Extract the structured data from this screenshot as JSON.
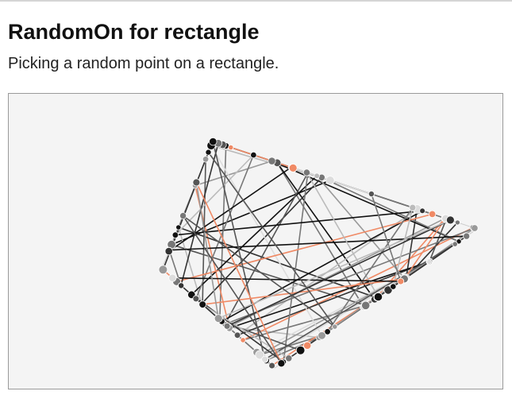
{
  "page": {
    "title": "RandomOn for rectangle",
    "subtitle": "Picking a random point on a rectangle."
  },
  "demo": {
    "colors": {
      "canvas_background": "#f4f4f4",
      "frame_border": "#9a9a9a",
      "accent": "#f08a65",
      "line_palette": [
        "#111111",
        "#333333",
        "#555555",
        "#777777",
        "#999999",
        "#bbbbbb",
        "#dddddd",
        "#f08a65"
      ]
    }
  }
}
